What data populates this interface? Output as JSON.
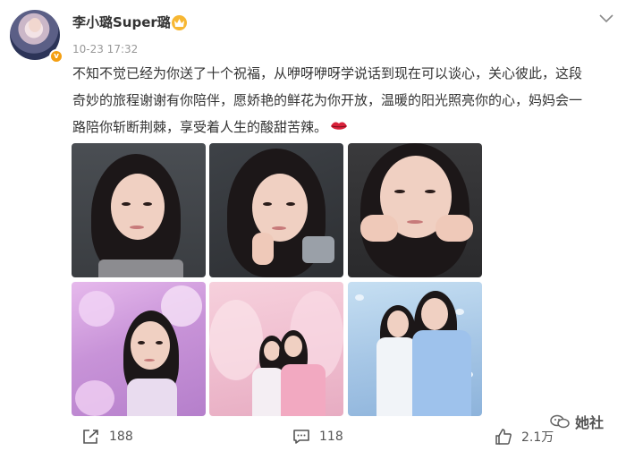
{
  "post": {
    "user_name": "李小璐Super璐",
    "time": "10-23 17:32",
    "verified_label": "v",
    "text_lines": [
      "不知不觉已经为你送了十个祝福，从咿呀咿呀学说话到现在可以谈心，关心彼此，这段",
      "奇妙的旅程谢谢有你陪伴，愿娇艳的鲜花为你开放，温暖的阳光照亮你的心，妈妈会一",
      "路陪你斩断荆棘，享受着人生的酸甜苦辣。"
    ],
    "emoji_icon": "lips-icon"
  },
  "photos": [
    {
      "name": "photo-1",
      "tone": "dark gray studio"
    },
    {
      "name": "photo-2",
      "tone": "dark gray studio"
    },
    {
      "name": "photo-3",
      "tone": "dark studio"
    },
    {
      "name": "photo-4",
      "tone": "purple floral"
    },
    {
      "name": "photo-5",
      "tone": "pink drapery"
    },
    {
      "name": "photo-6",
      "tone": "blue butterflies"
    }
  ],
  "watermark": {
    "text": "她社"
  },
  "footer": {
    "reposts": "188",
    "comments": "118",
    "likes": "2.1万"
  },
  "icons": {
    "more": "chevron-down-icon",
    "repost": "share-icon",
    "comment": "comment-icon",
    "like": "thumbs-up-icon"
  },
  "colors": {
    "verify_badge": "#f49f12",
    "text": "#333333",
    "muted": "#999999"
  }
}
